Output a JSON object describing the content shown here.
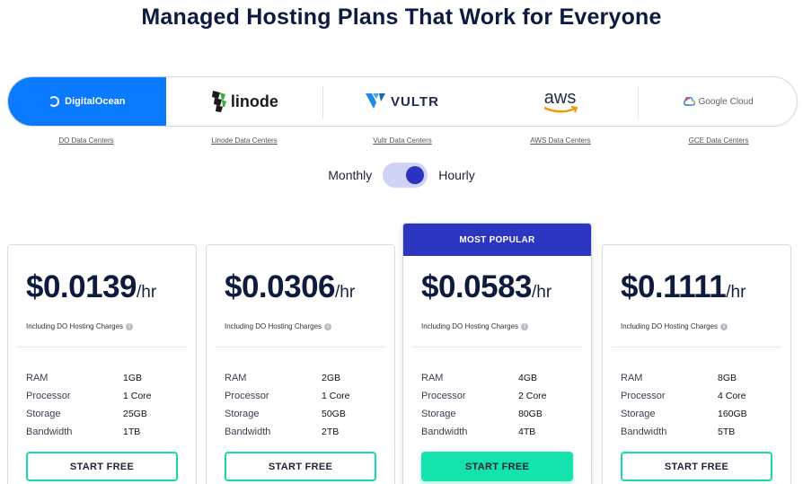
{
  "title": "Managed Hosting Plans That Work for Everyone",
  "providers": [
    {
      "name": "DigitalOcean",
      "link": "DO Data Centers",
      "active": true
    },
    {
      "name": "linode",
      "link": "Linode Data Centers",
      "active": false
    },
    {
      "name": "VULTR",
      "link": "Vultr Data Centers",
      "active": false
    },
    {
      "name": "aws",
      "link": "AWS Data Centers",
      "active": false
    },
    {
      "name": "Google Cloud",
      "link": "GCE Data Centers",
      "active": false
    }
  ],
  "billing": {
    "monthly": "Monthly",
    "hourly": "Hourly",
    "selected": "Hourly"
  },
  "spec_labels": {
    "ram": "RAM",
    "processor": "Processor",
    "storage": "Storage",
    "bandwidth": "Bandwidth"
  },
  "plans": [
    {
      "price": "$0.0139",
      "unit": "/hr",
      "note": "Including DO Hosting Charges",
      "ram": "1GB",
      "processor": "1 Core",
      "storage": "25GB",
      "bandwidth": "1TB",
      "cta": "START FREE"
    },
    {
      "price": "$0.0306",
      "unit": "/hr",
      "note": "Including DO Hosting Charges",
      "ram": "2GB",
      "processor": "1 Core",
      "storage": "50GB",
      "bandwidth": "2TB",
      "cta": "START FREE"
    },
    {
      "price": "$0.0583",
      "unit": "/hr",
      "note": "Including DO Hosting Charges",
      "ram": "4GB",
      "processor": "2 Core",
      "storage": "80GB",
      "bandwidth": "4TB",
      "cta": "START FREE",
      "badge": "MOST POPULAR"
    },
    {
      "price": "$0.1111",
      "unit": "/hr",
      "note": "Including DO Hosting Charges",
      "ram": "8GB",
      "processor": "4 Core",
      "storage": "160GB",
      "bandwidth": "5TB",
      "cta": "START FREE"
    }
  ],
  "colors": {
    "accent": "#0a7bff",
    "popular": "#2c35c0",
    "cta": "#15e3ad",
    "toggle": "#2b33c2"
  }
}
